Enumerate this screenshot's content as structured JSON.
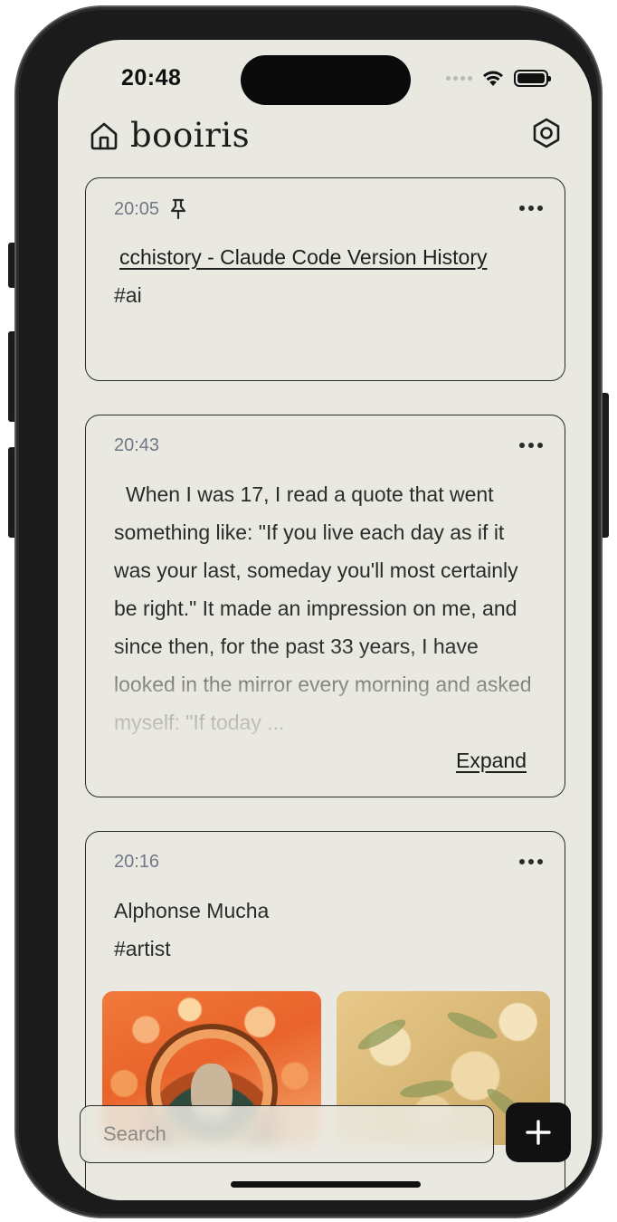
{
  "status_bar": {
    "time": "20:48"
  },
  "header": {
    "title": "booiris",
    "home_icon": "home-icon",
    "settings_icon": "settings-icon"
  },
  "cards": [
    {
      "time": "20:05",
      "pinned": true,
      "link_text": "cchistory - Claude Code Version History",
      "tag": "#ai"
    },
    {
      "time": "20:43",
      "text": "When I was 17, I read a quote that went something like: \"If you live each day as if it was your last, someday you'll most certainly be right.\" It made an impression on me, and since then, for the past 33 years, I have looked in the mirror every morning and asked myself: \"If today ...",
      "expand_label": "Expand"
    },
    {
      "time": "20:16",
      "title": "Alphonse Mucha",
      "tag": "#artist"
    }
  ],
  "search": {
    "placeholder": "Search",
    "value": ""
  },
  "add_button": {
    "icon": "plus-icon"
  },
  "colors": {
    "background": "#eae9e1",
    "text": "#2b2b2b",
    "meta": "#6f7884",
    "accent_dark": "#111111"
  }
}
